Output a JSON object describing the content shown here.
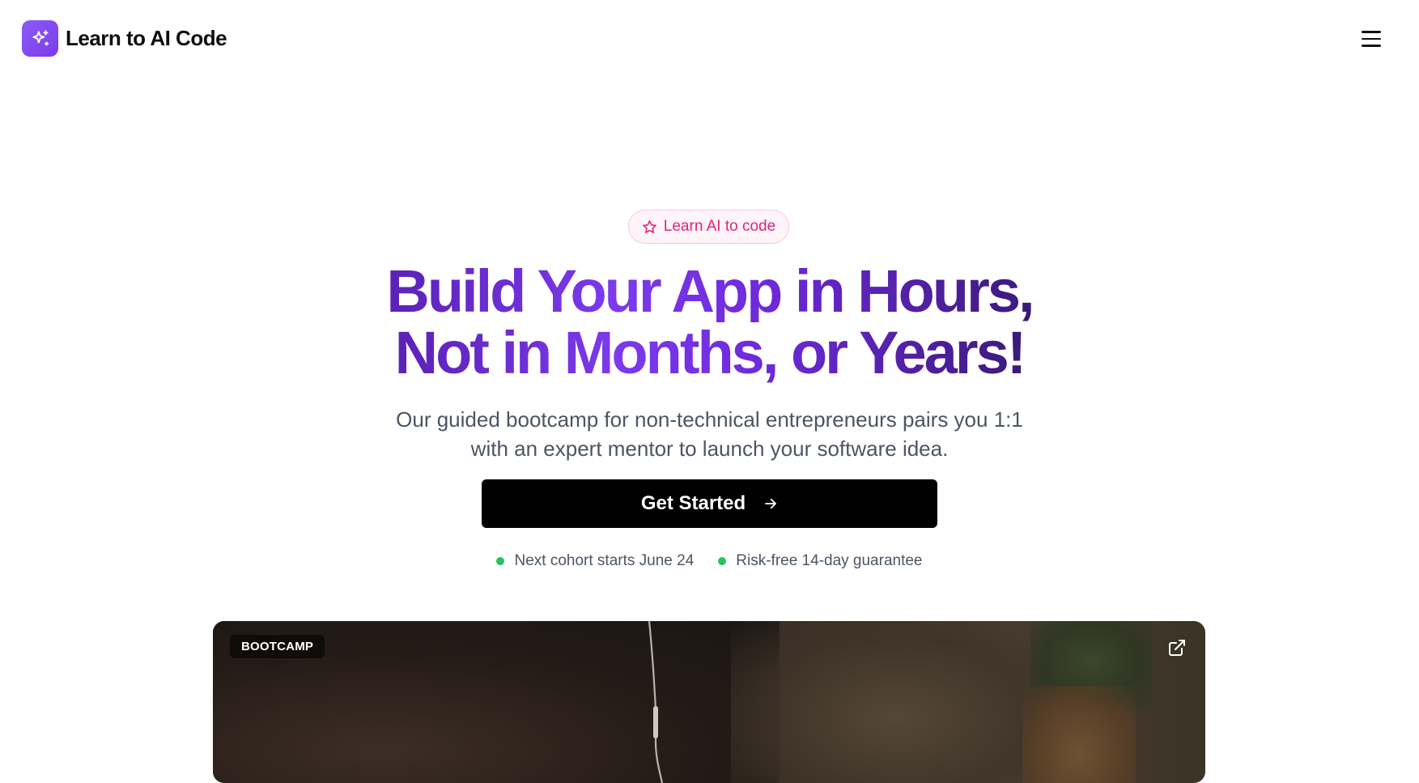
{
  "header": {
    "brand_name": "Learn to AI Code",
    "logo_icon": "sparkles-icon",
    "menu_icon": "hamburger-menu-icon"
  },
  "hero": {
    "badge_icon": "star-icon",
    "badge_text": "Learn AI to code",
    "headline_line1": "Build Your App in Hours,",
    "headline_line2": "Not in Months, or Years!",
    "subtitle_line1": "Our guided bootcamp for non-technical entrepreneurs pairs you 1:1",
    "subtitle_line2": "with an expert mentor to launch your software idea.",
    "cta_label": "Get Started",
    "cta_icon": "arrow-right-icon",
    "perks": [
      "Next cohort starts June 24",
      "Risk-free 14-day guarantee"
    ]
  },
  "media": {
    "tag": "BOOTCAMP",
    "link_icon": "external-link-icon"
  },
  "colors": {
    "brand": "#7c3aed",
    "badge_text": "#db2777",
    "perk_dot": "#22c55e",
    "cta_bg": "#000000"
  }
}
